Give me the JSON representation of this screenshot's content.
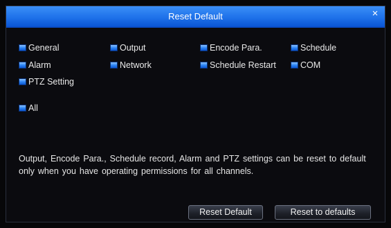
{
  "dialog": {
    "title": "Reset Default",
    "close_symbol": "×"
  },
  "options": {
    "general": "General",
    "output": "Output",
    "encode_para": "Encode Para.",
    "schedule": "Schedule",
    "alarm": "Alarm",
    "network": "Network",
    "schedule_restart": "Schedule Restart",
    "com": "COM",
    "ptz_setting": "PTZ Setting",
    "all": "All"
  },
  "note": "Output, Encode Para., Schedule record, Alarm and PTZ settings can be reset to default only when you have operating permissions for all channels.",
  "buttons": {
    "reset_default": "Reset Default",
    "reset_to_defaults": "Reset to defaults"
  },
  "colors": {
    "title_bar": "#1f72ea",
    "checkbox": "#2f86f5",
    "background": "#0b0b0f"
  }
}
